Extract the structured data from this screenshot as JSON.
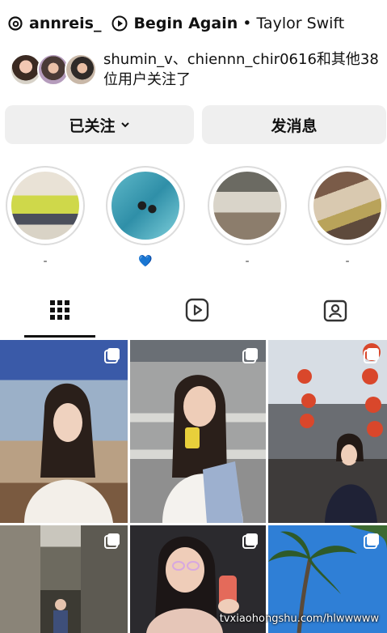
{
  "header": {
    "threads_icon": "threads-icon",
    "username": "annreis_",
    "music_icon": "play-circle-icon",
    "song_title": "Begin Again",
    "separator": "•",
    "artist": "Taylor Swift"
  },
  "followed_by": {
    "text": "shumin_v、chiennn_chir0616和其他38位用户关注了"
  },
  "buttons": {
    "follow_label": "已关注",
    "message_label": "发消息"
  },
  "highlights": [
    {
      "label": "-"
    },
    {
      "label": "💙"
    },
    {
      "label": "-"
    },
    {
      "label": "-"
    }
  ],
  "tabs": [
    {
      "icon": "grid-icon"
    },
    {
      "icon": "reels-icon"
    },
    {
      "icon": "tagged-icon"
    }
  ],
  "watermark": "tvxiaohongshu.com/hlwwwww"
}
